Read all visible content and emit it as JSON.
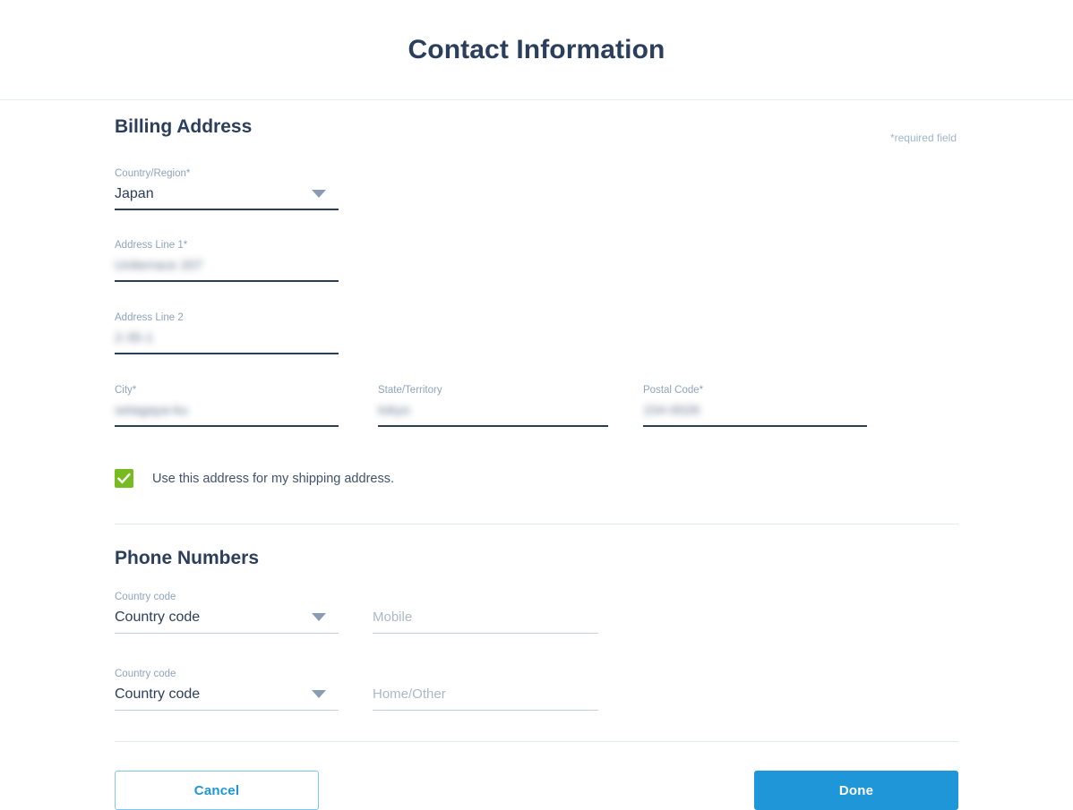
{
  "header": {
    "title": "Contact Information"
  },
  "billing": {
    "section_title": "Billing Address",
    "required_note": "*required field",
    "fields": {
      "country": {
        "label": "Country/Region*",
        "value": "Japan",
        "caret_icon": "chevron-down-icon"
      },
      "address1": {
        "label": "Address Line 1*",
        "value": "Uniterrace 207"
      },
      "address2": {
        "label": "Address Line 2",
        "value": "2-35-1"
      },
      "city": {
        "label": "City*",
        "value": "setagaya-ku"
      },
      "state": {
        "label": "State/Territory",
        "value": "tokyo"
      },
      "postal": {
        "label": "Postal Code*",
        "value": "154-0026"
      }
    },
    "shipping_checkbox": {
      "label": "Use this address for my shipping address.",
      "checked": true,
      "check_icon": "check-icon",
      "color": "#76bc21"
    }
  },
  "phone": {
    "section_title": "Phone Numbers",
    "rows": [
      {
        "country_code_label": "Country code",
        "country_code_value": "Country code",
        "number_placeholder": "Mobile",
        "number_value": ""
      },
      {
        "country_code_label": "Country code",
        "country_code_value": "Country code",
        "number_placeholder": "Home/Other",
        "number_value": ""
      }
    ]
  },
  "actions": {
    "cancel_label": "Cancel",
    "done_label": "Done",
    "accent_color": "#1f96d8"
  }
}
